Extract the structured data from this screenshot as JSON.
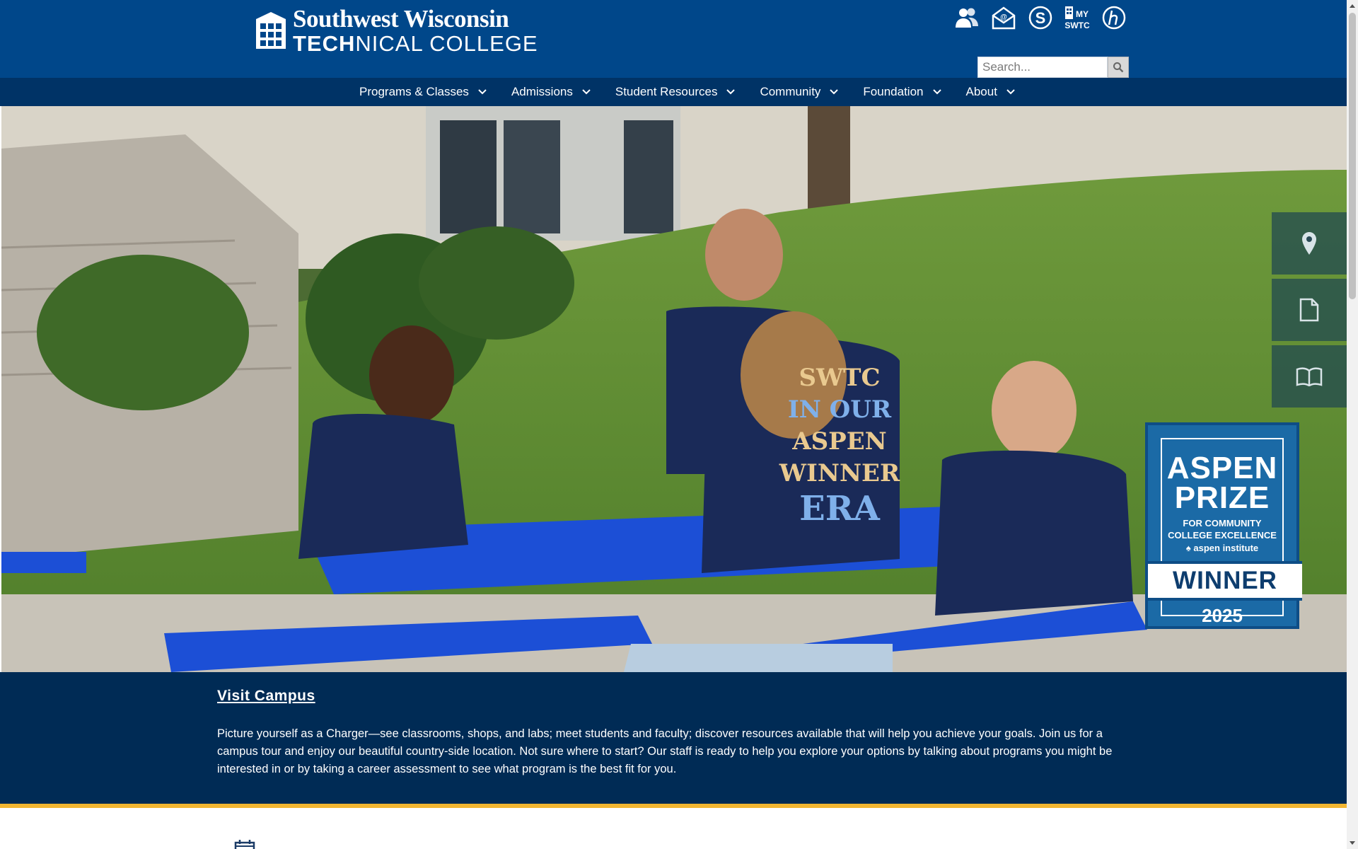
{
  "header": {
    "logo_line1": "Southwest Wisconsin",
    "logo_line2_bold": "TECH",
    "logo_line2_rest": "NICAL COLLEGE",
    "quick_links": [
      {
        "icon": "people-icon"
      },
      {
        "icon": "email-icon"
      },
      {
        "icon": "dollar-s-icon"
      },
      {
        "icon": "my-swtc-icon",
        "text_top": "MY",
        "text_bottom": "SWTC"
      },
      {
        "icon": "canvas-h-icon"
      }
    ],
    "search": {
      "placeholder": "Search...",
      "value": ""
    }
  },
  "nav": {
    "items": [
      {
        "label": "Programs & Classes"
      },
      {
        "label": "Admissions"
      },
      {
        "label": "Student Resources"
      },
      {
        "label": "Community"
      },
      {
        "label": "Foundation"
      },
      {
        "label": "About"
      }
    ]
  },
  "hero": {
    "side_tabs": [
      {
        "icon": "location-pin-icon"
      },
      {
        "icon": "document-icon"
      },
      {
        "icon": "open-book-icon"
      }
    ],
    "shirt_text": [
      "SWTC",
      "IN OUR",
      "ASPEN",
      "WINNER",
      "ERA"
    ],
    "badge": {
      "line1": "ASPEN",
      "line2": "PRIZE",
      "sub1": "FOR COMMUNITY",
      "sub2": "COLLEGE EXCELLENCE",
      "institute": "aspen institute",
      "winner": "WINNER",
      "year": "2025"
    }
  },
  "info": {
    "link": "Visit Campus",
    "text": "Picture yourself as a Charger—see classrooms, shops, and labs; meet students and faculty; discover resources available that will help you achieve your goals. Join us for a campus tour and enjoy our beautiful country-side location. Not sure where to start? Our staff is ready to help you explore your options by talking about programs you might be interested in or by taking a career assessment to see what program is the best fit for you."
  },
  "colors": {
    "header_blue": "#00478a",
    "nav_blue": "#003366",
    "band_navy": "#002b55",
    "gold": "#f2b632",
    "table_blue": "#1c4fd6"
  }
}
